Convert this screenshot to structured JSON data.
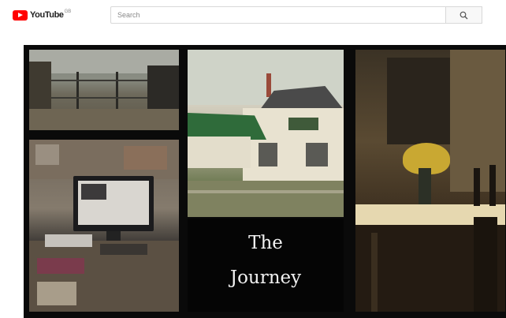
{
  "header": {
    "logo_text": "YouTube",
    "logo_region": "GB",
    "search_placeholder": "Search",
    "search_icon": "search-icon"
  },
  "video": {
    "title_line1": "The",
    "title_line2": "Journey"
  },
  "colors": {
    "brand_red": "#ff0000",
    "video_background": "#0a0a0a"
  }
}
